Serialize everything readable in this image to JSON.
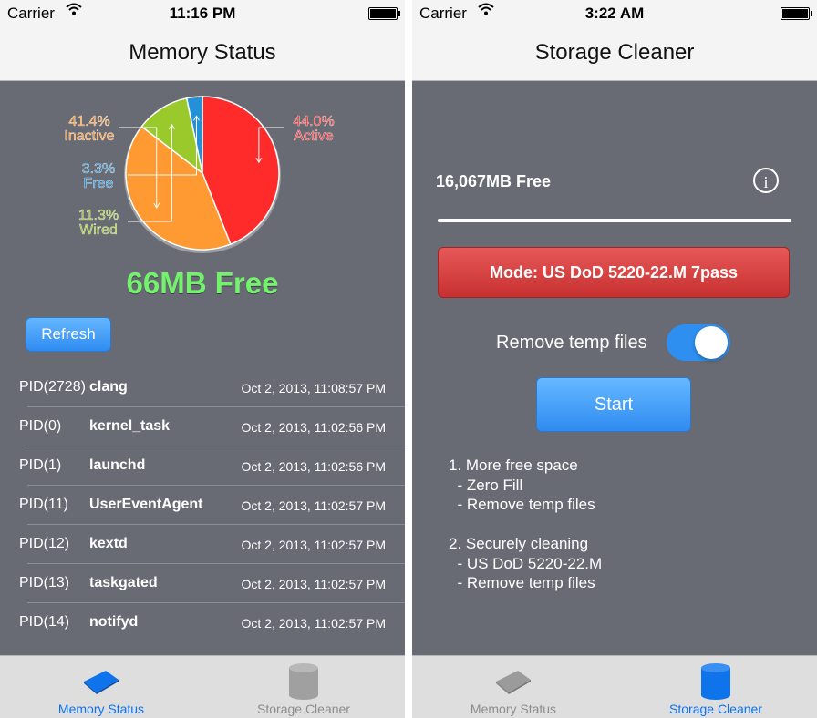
{
  "left": {
    "status": {
      "carrier": "Carrier",
      "time": "11:16 PM"
    },
    "nav_title": "Memory Status",
    "chart_data": {
      "type": "pie",
      "slices": [
        {
          "label": "Active",
          "percent_label": "44.0%",
          "value": 44.0,
          "color": "#ff2b2b"
        },
        {
          "label": "Inactive",
          "percent_label": "41.4%",
          "value": 41.4,
          "color": "#ff9a33"
        },
        {
          "label": "Wired",
          "percent_label": "11.3%",
          "value": 11.3,
          "color": "#9ac92b"
        },
        {
          "label": "Free",
          "percent_label": "3.3%",
          "value": 3.3,
          "color": "#2490d6"
        }
      ]
    },
    "free_text": "66MB Free",
    "refresh_label": "Refresh",
    "processes": [
      {
        "pid": "PID(2728)",
        "name": "clang",
        "date": "Oct 2, 2013, 11:08:57 PM"
      },
      {
        "pid": "PID(0)",
        "name": "kernel_task",
        "date": "Oct 2, 2013, 11:02:56 PM"
      },
      {
        "pid": "PID(1)",
        "name": "launchd",
        "date": "Oct 2, 2013, 11:02:56 PM"
      },
      {
        "pid": "PID(11)",
        "name": "UserEventAgent",
        "date": "Oct 2, 2013, 11:02:57 PM"
      },
      {
        "pid": "PID(12)",
        "name": "kextd",
        "date": "Oct 2, 2013, 11:02:57 PM"
      },
      {
        "pid": "PID(13)",
        "name": "taskgated",
        "date": "Oct 2, 2013, 11:02:57 PM"
      },
      {
        "pid": "PID(14)",
        "name": "notifyd",
        "date": "Oct 2, 2013, 11:02:57 PM"
      }
    ],
    "tabs": [
      {
        "label": "Memory Status",
        "icon": "memory-chip-icon",
        "active": true
      },
      {
        "label": "Storage Cleaner",
        "icon": "storage-cylinder-icon",
        "active": false
      }
    ]
  },
  "right": {
    "status": {
      "carrier": "Carrier",
      "time": "3:22 AM"
    },
    "nav_title": "Storage Cleaner",
    "free_text": "16,067MB Free",
    "info_icon": "info-icon",
    "progress": 1.0,
    "mode_label": "Mode: US DoD 5220-22.M 7pass",
    "toggle_label": "Remove temp files",
    "toggle_on": true,
    "start_label": "Start",
    "notes": [
      "1. More free space",
      "  - Zero Fill",
      "  - Remove temp files",
      "",
      "2. Securely cleaning",
      "  - US DoD 5220-22.M",
      "  - Remove temp files"
    ],
    "tabs": [
      {
        "label": "Memory Status",
        "icon": "memory-chip-icon",
        "active": false
      },
      {
        "label": "Storage Cleaner",
        "icon": "storage-cylinder-icon",
        "active": true
      }
    ]
  }
}
